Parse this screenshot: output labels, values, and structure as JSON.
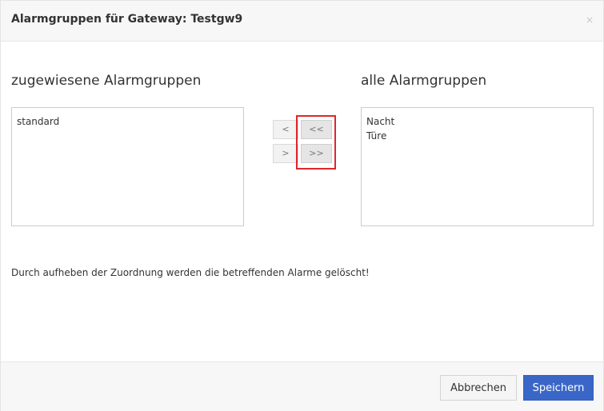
{
  "header": {
    "title": "Alarmgruppen für Gateway: Testgw9",
    "close_symbol": "×"
  },
  "assigned": {
    "heading": "zugewiesene Alarmgruppen",
    "items": [
      "standard"
    ]
  },
  "available": {
    "heading": "alle Alarmgruppen",
    "items": [
      "Nacht",
      "Türe"
    ]
  },
  "transfer": {
    "move_one_left": "<",
    "move_all_left": "<<",
    "move_one_right": ">",
    "move_all_right": ">>"
  },
  "notice": "Durch aufheben der Zuordnung werden die betreffenden Alarme gelöscht!",
  "footer": {
    "cancel_label": "Abbrechen",
    "save_label": "Speichern"
  },
  "colors": {
    "primary": "#3a67c7",
    "highlight": "#e0262b"
  }
}
